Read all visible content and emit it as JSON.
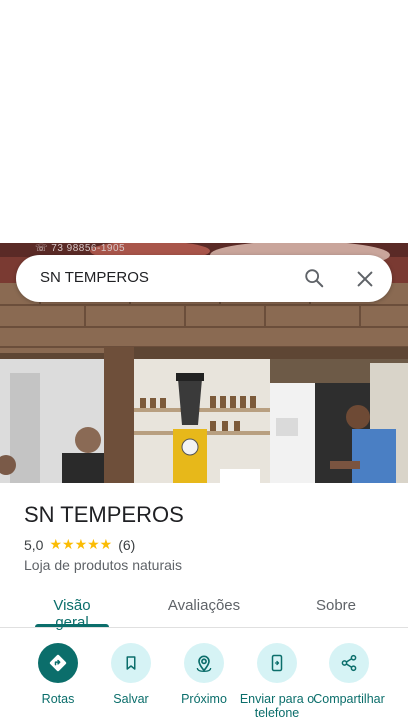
{
  "photo": {
    "phone_text": "☏ 73 98856-1905"
  },
  "search": {
    "query": "SN TEMPEROS"
  },
  "place": {
    "name": "SN TEMPEROS",
    "rating": "5,0",
    "stars": "★★★★★",
    "review_count": "(6)",
    "category": "Loja de produtos naturais"
  },
  "tabs": [
    {
      "label": "Visão geral",
      "active": true
    },
    {
      "label": "Avaliações",
      "active": false
    },
    {
      "label": "Sobre",
      "active": false
    }
  ],
  "actions": [
    {
      "label": "Rotas",
      "icon": "directions-icon"
    },
    {
      "label": "Salvar",
      "icon": "bookmark-icon"
    },
    {
      "label": "Próximo",
      "icon": "nearby-icon"
    },
    {
      "label": "Enviar para o telefone",
      "icon": "send-to-phone-icon"
    },
    {
      "label": "Compartilhar",
      "icon": "share-icon"
    }
  ],
  "colors": {
    "accent": "#0b6e6b",
    "action_bg": "#d6f3f5",
    "star": "#fbbc04"
  }
}
